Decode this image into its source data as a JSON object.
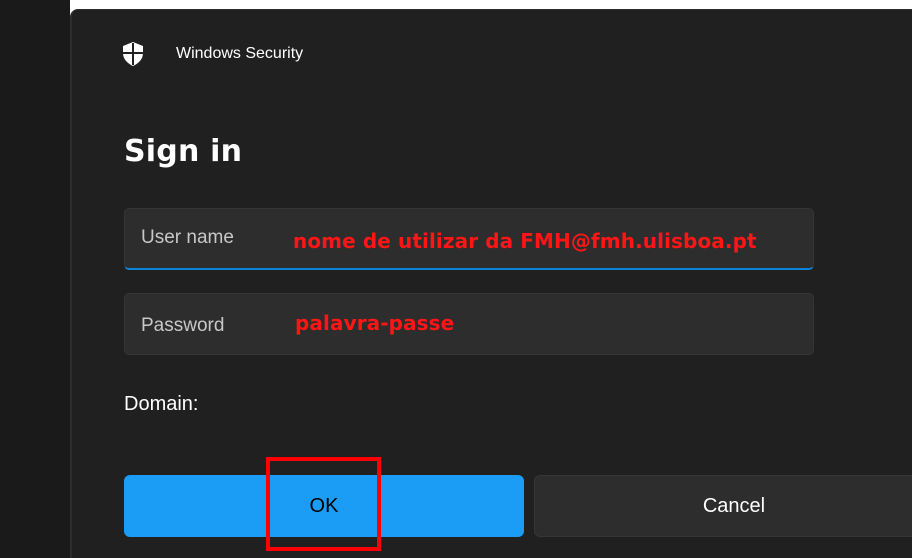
{
  "window": {
    "app_title": "Windows Security",
    "shield_icon": "shield-icon"
  },
  "dialog": {
    "heading": "Sign in",
    "username_field": {
      "placeholder": "User name",
      "value": "",
      "annotation": "nome de utilizar da FMH@fmh.ulisboa.pt"
    },
    "password_field": {
      "placeholder": "Password",
      "value": "",
      "annotation": "palavra-passe"
    },
    "domain_label": "Domain:",
    "buttons": {
      "ok_label": "OK",
      "cancel_label": "Cancel"
    }
  },
  "colors": {
    "dialog_background": "#202020",
    "field_background": "#2d2d2d",
    "accent": "#1b9cf5",
    "focus_underline": "#0a84d8",
    "annotation_red": "#ff1515"
  }
}
